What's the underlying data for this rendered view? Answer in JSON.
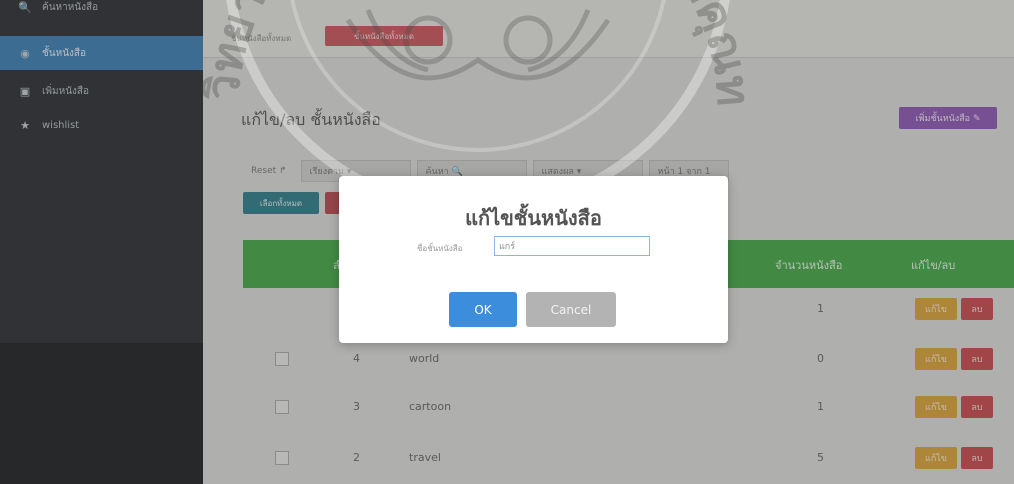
{
  "sidebar": {
    "items": [
      {
        "icon": "search-icon",
        "glyph": "🔍",
        "label": "ค้นหาหนังสือ"
      },
      {
        "icon": "book-icon",
        "glyph": "◉",
        "label": "ชั้นหนังสือ"
      },
      {
        "icon": "add-book-icon",
        "glyph": "▣",
        "label": "เพิ่มหนังสือ"
      },
      {
        "icon": "star-icon",
        "glyph": "★",
        "label": "wishlist"
      }
    ]
  },
  "topbar": {
    "breadcrumb": "ชั้นหนังสือทั้งหมด",
    "action_label": "ชั้นหนังสือทั้งหมด"
  },
  "page": {
    "title": "แก้ไข/ลบ ชั้นหนังสือ",
    "add_button": "เพิ่มชั้นหนังสือ ✎"
  },
  "filters": {
    "reset": "Reset ↱",
    "sort_by": "เรียงตาม ▾",
    "keyword": "ค้นหา 🔍",
    "per_page": "แสดงผล ▾",
    "page_info": "หน้า 1 จาก 1"
  },
  "actions": {
    "select_all": "เลือกทั้งหมด"
  },
  "table": {
    "headers": {
      "id": "ลำดับ",
      "count": "จำนวนหนังสือ",
      "edit_delete": "แก้ไข/ลบ"
    },
    "rows": [
      {
        "num": "",
        "name": "",
        "count": "1",
        "edit": "แก้ไข",
        "delete": "ลบ"
      },
      {
        "num": "4",
        "name": "world",
        "count": "0",
        "edit": "แก้ไข",
        "delete": "ลบ"
      },
      {
        "num": "3",
        "name": "cartoon",
        "count": "1",
        "edit": "แก้ไข",
        "delete": "ลบ"
      },
      {
        "num": "2",
        "name": "travel",
        "count": "5",
        "edit": "แก้ไข",
        "delete": "ลบ"
      }
    ]
  },
  "modal": {
    "title": "แก้ไขชั้นหนังสือ",
    "field_label": "ชื่อชั้นหนังสือ",
    "field_value": "แกร์",
    "ok": "OK",
    "cancel": "Cancel"
  },
  "watermark": {
    "text": "มหาวิทยาลัยราชภัฏพระจอมเกล้าเจ้าคุณทหาร"
  },
  "colors": {
    "sidebar_active": "#3d7fb5",
    "table_header": "#45a846",
    "add_button": "#8e57b4",
    "ok_button": "#3d8ddd",
    "edit_button": "#d9a23a",
    "delete_button": "#c64a4e"
  }
}
